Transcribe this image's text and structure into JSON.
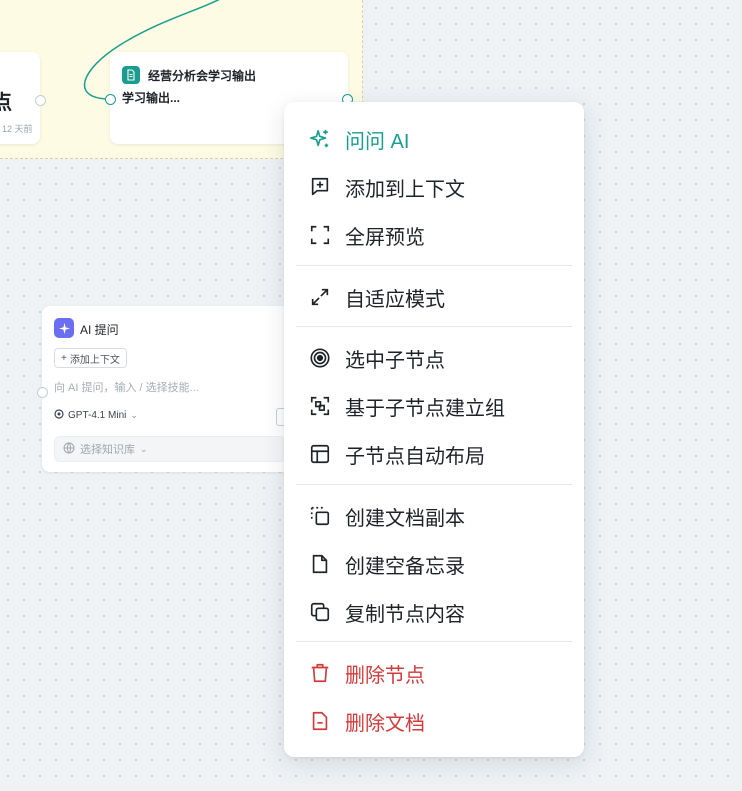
{
  "canvas": {
    "left_node": {
      "text": "点",
      "meta": "12 天前"
    },
    "doc_node": {
      "title": "经营分析会学习输出",
      "subtitle": "学习输出..."
    },
    "ai_node": {
      "title": "AI 提问",
      "add_context": "添加上下文",
      "input_placeholder": "向 AI 提问，输入 / 选择技能...",
      "model": "GPT-4.1 Mini",
      "knowledge_base": "选择知识库"
    }
  },
  "context_menu": {
    "ask_ai": "问问 AI",
    "add_to_context": "添加到上下文",
    "fullscreen_preview": "全屏预览",
    "adaptive_mode": "自适应模式",
    "select_children": "选中子节点",
    "group_children": "基于子节点建立组",
    "auto_layout_children": "子节点自动布局",
    "create_doc_copy": "创建文档副本",
    "create_empty_memo": "创建空备忘录",
    "copy_node_content": "复制节点内容",
    "delete_node": "删除节点",
    "delete_document": "删除文档"
  },
  "colors": {
    "accent": "#1a9d8f",
    "danger": "#d13b3b",
    "group_bg": "#fdfbe3",
    "ai_badge": "#6a6ef0"
  }
}
